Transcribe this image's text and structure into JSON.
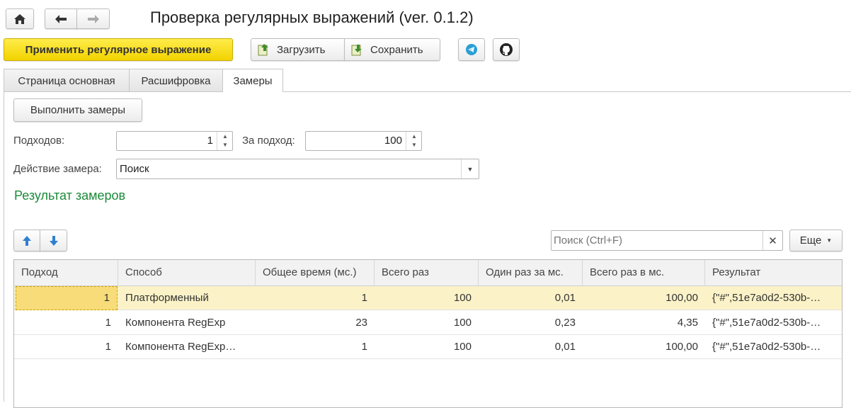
{
  "header": {
    "title": "Проверка регулярных выражений (ver. 0.1.2)",
    "home_icon": "home-icon",
    "back_icon": "arrow-left-icon",
    "forward_icon": "arrow-right-icon"
  },
  "toolbar": {
    "apply_label": "Применить регулярное выражение",
    "load_label": "Загрузить",
    "save_label": "Сохранить",
    "telegram_icon": "telegram-icon",
    "github_icon": "github-icon"
  },
  "tabs": [
    {
      "label": "Страница основная",
      "active": false
    },
    {
      "label": "Расшифровка",
      "active": false
    },
    {
      "label": "Замеры",
      "active": true
    }
  ],
  "measure": {
    "run_label": "Выполнить замеры",
    "approaches_label": "Подходов:",
    "approaches_value": "1",
    "per_approach_label": "За подход:",
    "per_approach_value": "100",
    "action_label": "Действие замера:",
    "action_value": "Поиск",
    "results_title": "Результат замеров"
  },
  "table_toolbar": {
    "up_icon": "arrow-up-icon",
    "down_icon": "arrow-down-icon",
    "search_placeholder": "Поиск (Ctrl+F)",
    "clear_icon": "close-icon",
    "more_label": "Еще"
  },
  "table": {
    "columns": [
      "Подход",
      "Способ",
      "Общее время (мс.)",
      "Всего раз",
      "Один раз за мс.",
      "Всего раз в мс.",
      "Результат"
    ],
    "rows": [
      {
        "approach": "1",
        "method": "Платформенный",
        "total_time": "1",
        "total_count": "100",
        "once_ms": "0,01",
        "per_ms": "100,00",
        "result": "{\"#\",51e7a0d2-530b-…",
        "selected": true
      },
      {
        "approach": "1",
        "method": "Компонента RegExp",
        "total_time": "23",
        "total_count": "100",
        "once_ms": "0,23",
        "per_ms": "4,35",
        "result": "{\"#\",51e7a0d2-530b-…",
        "selected": false
      },
      {
        "approach": "1",
        "method": "Компонента RegExp…",
        "total_time": "1",
        "total_count": "100",
        "once_ms": "0,01",
        "per_ms": "100,00",
        "result": "{\"#\",51e7a0d2-530b-…",
        "selected": false
      }
    ]
  },
  "colors": {
    "accent_yellow": "#f5d800",
    "selected_row": "#fbf2c7",
    "section_title": "#1c8a3a",
    "telegram": "#2a9fd6",
    "arrow_blue": "#2f7fd0"
  }
}
